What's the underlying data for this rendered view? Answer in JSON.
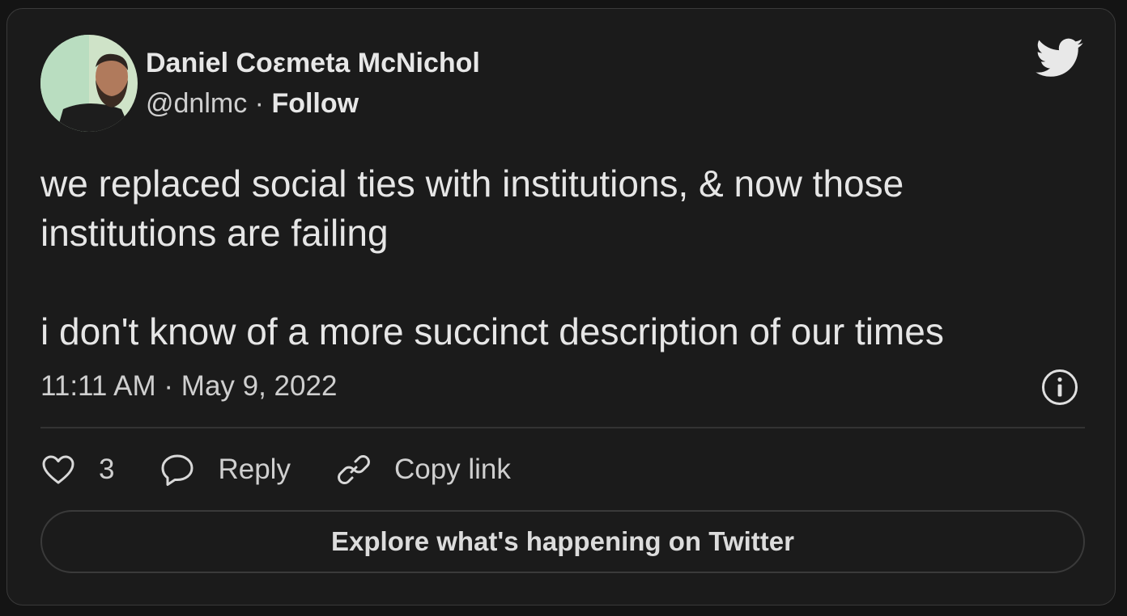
{
  "author": {
    "name": "Daniel Coεmeta McNichol",
    "handle": "@dnlmc",
    "separator": "·",
    "follow_label": "Follow"
  },
  "icons": {
    "brand": "twitter-bird-icon",
    "info": "info-icon",
    "like": "heart-icon",
    "reply": "speech-bubble-icon",
    "copy": "link-icon"
  },
  "tweet": {
    "lines": [
      "we replaced social ties with institutions, & now those",
      "institutions are failing",
      "",
      "i don't know of a more succinct description of our times"
    ],
    "timestamp": "11:11 AM · May 9, 2022"
  },
  "actions": {
    "like_count": "3",
    "reply_label": "Reply",
    "copy_link_label": "Copy link"
  },
  "explore_label": "Explore what's happening on Twitter",
  "colors": {
    "background": "#1b1b1b",
    "text": "#e6e6e6",
    "border": "#3a3a3a"
  }
}
